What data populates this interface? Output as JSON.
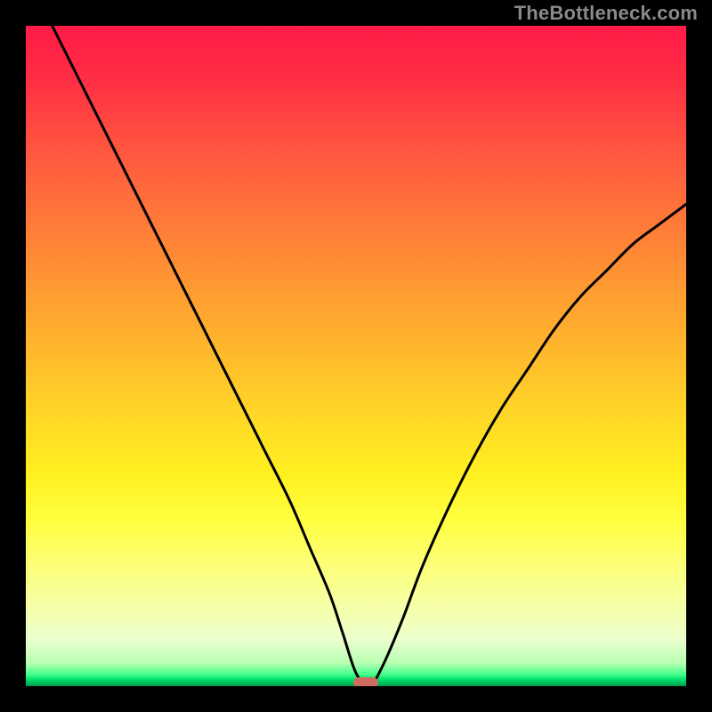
{
  "watermark": "TheBottleneck.com",
  "colors": {
    "frame": "#000000",
    "curve_stroke": "#000000",
    "marker_fill": "#cf6a60"
  },
  "plot": {
    "inner_left": 29,
    "inner_top": 29,
    "inner_size": 742
  },
  "chart_data": {
    "type": "line",
    "title": "",
    "xlabel": "",
    "ylabel": "",
    "xlim": [
      0,
      100
    ],
    "ylim": [
      0,
      100
    ],
    "grid": false,
    "legend": null,
    "annotations": [],
    "series": [
      {
        "name": "bottleneck-curve",
        "x": [
          0,
          4,
          8,
          12,
          16,
          20,
          24,
          28,
          32,
          36,
          40,
          43,
          46,
          48,
          50,
          52,
          54,
          57,
          60,
          64,
          68,
          72,
          76,
          80,
          84,
          88,
          92,
          96,
          100
        ],
        "y": [
          108,
          100,
          92,
          84,
          76,
          68,
          60,
          52,
          44,
          36,
          28,
          21,
          14,
          8,
          2,
          0,
          3,
          10,
          18,
          27,
          35,
          42,
          48,
          54,
          59,
          63,
          67,
          70,
          73
        ]
      }
    ],
    "marker": {
      "x": 51.5,
      "y": 0.5
    },
    "gradient_stops": [
      {
        "pct": 0,
        "color": "#ff1a46"
      },
      {
        "pct": 8,
        "color": "#ff2e44"
      },
      {
        "pct": 20,
        "color": "#ff5a3f"
      },
      {
        "pct": 33,
        "color": "#ff8436"
      },
      {
        "pct": 46,
        "color": "#ffae2e"
      },
      {
        "pct": 58,
        "color": "#ffd427"
      },
      {
        "pct": 68,
        "color": "#fff020"
      },
      {
        "pct": 75,
        "color": "#ffff40"
      },
      {
        "pct": 82,
        "color": "#fcff7a"
      },
      {
        "pct": 88,
        "color": "#f6ffa8"
      },
      {
        "pct": 93,
        "color": "#eaffce"
      },
      {
        "pct": 96.5,
        "color": "#b8ffb1"
      },
      {
        "pct": 98.2,
        "color": "#46ff8c"
      },
      {
        "pct": 99.0,
        "color": "#00e06c"
      },
      {
        "pct": 99.6,
        "color": "#00b85a"
      },
      {
        "pct": 100,
        "color": "#009a4e"
      }
    ]
  }
}
